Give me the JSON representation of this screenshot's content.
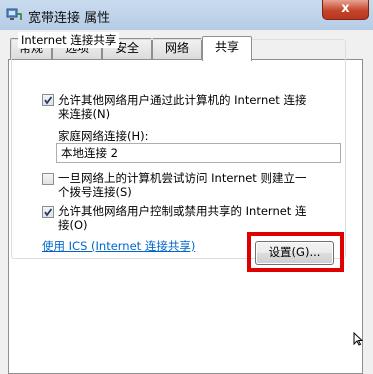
{
  "window": {
    "title": "宽带连接 属性",
    "close_label": "x"
  },
  "tabs": [
    {
      "label": "常规",
      "active": false
    },
    {
      "label": "选项",
      "active": false
    },
    {
      "label": "安全",
      "active": false
    },
    {
      "label": "网络",
      "active": false
    },
    {
      "label": "共享",
      "active": true
    }
  ],
  "sharing": {
    "group_title": "Internet 连接共享",
    "allow_sharing": {
      "line1": "允许其他网络用户通过此计算机的 Internet 连接",
      "line2": "来连接(N)",
      "checked": true
    },
    "home_network_label": "家庭网络连接(H):",
    "home_network_value": "本地连接 2",
    "dial_on_demand": {
      "line1": "一旦网络上的计算机尝试访问 Internet 则建立一",
      "line2": "个拨号连接(S)",
      "checked": false
    },
    "allow_control": {
      "line1": "允许其他网络用户控制或禁用共享的 Internet 连",
      "line2": "接(O)",
      "checked": true
    },
    "ics_link": "使用 ICS (Internet 连接共享)",
    "settings_button": "设置(G)..."
  },
  "colors": {
    "highlight": "#e00000",
    "link": "#0066cc",
    "close_button": "#c4452b"
  }
}
